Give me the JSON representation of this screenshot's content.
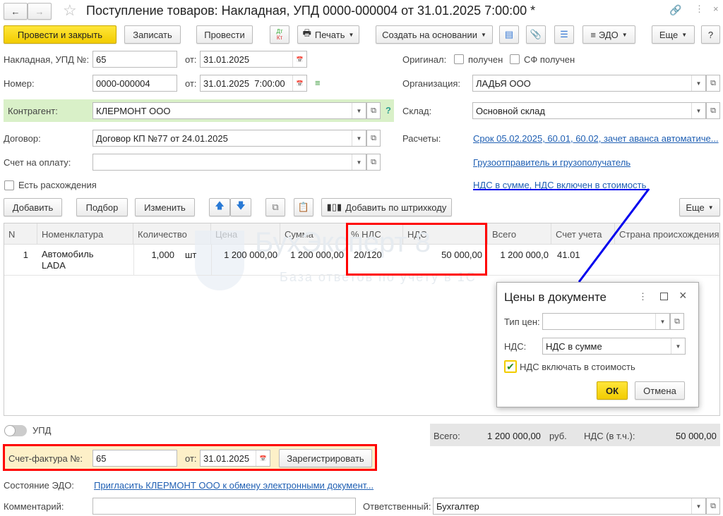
{
  "title": "Поступление товаров: Накладная, УПД 0000-000004 от 31.01.2025 7:00:00 *",
  "toolbar": {
    "post_close": "Провести и закрыть",
    "save": "Записать",
    "post": "Провести",
    "dtkt_top": "Дт",
    "dtkt_bottom": "Кт",
    "print": "Печать",
    "create_based": "Создать на основании",
    "edo": "ЭДО",
    "more": "Еще",
    "help": "?"
  },
  "header": {
    "invoice_label": "Накладная, УПД №:",
    "invoice_value": "65",
    "from": "от:",
    "invoice_date": "31.01.2025",
    "number_label": "Номер:",
    "number_value": "0000-000004",
    "number_date": "31.01.2025  7:00:00",
    "contractor_label": "Контрагент:",
    "contractor_value": "КЛЕРМОНТ ООО",
    "help": "?",
    "contract_label": "Договор:",
    "contract_value": "Договор КП №77 от 24.01.2025",
    "payment_invoice_label": "Счет на оплату:",
    "payment_invoice_value": "",
    "discrepancy_label": "Есть расхождения",
    "original_label": "Оригинал:",
    "received": "получен",
    "sf_received": "СФ получен",
    "org_label": "Организация:",
    "org_value": "ЛАДЬЯ ООО",
    "warehouse_label": "Склад:",
    "warehouse_value": "Основной склад",
    "settlements_label": "Расчеты:",
    "settlements_link": "Срок 05.02.2025, 60.01, 60.02, зачет аванса автоматиче...",
    "shipper_link": "Грузоотправитель и грузополучатель",
    "vat_link": "НДС в сумме, НДС включен в стоимость"
  },
  "table_toolbar": {
    "add": "Добавить",
    "select": "Подбор",
    "edit": "Изменить",
    "barcode": "Добавить по штрихкоду",
    "more": "Еще"
  },
  "table": {
    "columns": [
      "N",
      "Номенклатура",
      "Количество",
      "Цена",
      "Сумма",
      "% НДС",
      "НДС",
      "Всего",
      "Счет учета",
      "Страна происхождения"
    ],
    "rows": [
      {
        "n": "1",
        "item_line1": "Автомобиль",
        "item_line2": "LADA",
        "qty": "1,000",
        "unit": "шт",
        "price": "1 200 000,00",
        "sum": "1 200 000,00",
        "vat_rate": "20/120",
        "vat": "50 000,00",
        "total": "1 200 000,0",
        "account": "41.01",
        "country": ""
      }
    ]
  },
  "watermark": {
    "brand": "БухЭксперт 8",
    "tagline": "База ответов по учету в 1С"
  },
  "dialog": {
    "title": "Цены в документе",
    "price_type_label": "Тип цен:",
    "price_type_value": "",
    "vat_label": "НДС:",
    "vat_value": "НДС в сумме",
    "include_vat": "НДС включать в стоимость",
    "include_vat_checked": true,
    "ok": "ОК",
    "cancel": "Отмена"
  },
  "footer": {
    "upd_label": "УПД",
    "totals_label": "Всего:",
    "totals_value": "1 200 000,00",
    "currency": "руб.",
    "vat_label": "НДС (в т.ч.):",
    "vat_value": "50 000,00",
    "sf_label": "Счет-фактура №:",
    "sf_value": "65",
    "from": "от:",
    "sf_date": "31.01.2025",
    "register": "Зарегистрировать",
    "edo_state_label": "Состояние ЭДО:",
    "edo_link": "Пригласить КЛЕРМОНТ ООО к обмену электронными документ...",
    "comment_label": "Комментарий:",
    "comment_value": "",
    "responsible_label": "Ответственный:",
    "responsible_value": "Бухгалтер"
  },
  "colors": {
    "accent": "#f2cc00",
    "link": "#1f5fb3",
    "highlight": "#ff0000",
    "annotation": "#0000ee",
    "contractor_bg": "#d9f0c8"
  }
}
